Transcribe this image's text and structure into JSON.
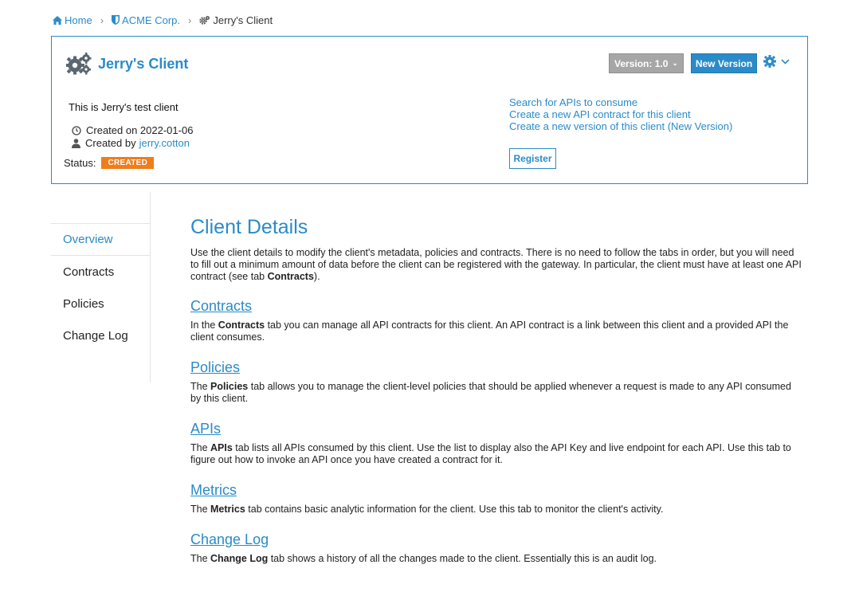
{
  "breadcrumb": {
    "home": "Home",
    "org": "ACME Corp.",
    "client": "Jerry's Client"
  },
  "header": {
    "title": "Jerry's Client",
    "version_label": "Version: 1.0",
    "new_version_label": "New Version",
    "description": "This is Jerry's test client",
    "created_on": "Created on 2022-01-06",
    "created_by_prefix": "Created by",
    "created_by_user": "jerry.cotton",
    "status_label": "Status:",
    "status_value": "CREATED",
    "links": {
      "search_apis": "Search for APIs to consume",
      "create_contract": "Create a new API contract for this client",
      "create_version": "Create a new version of this client (New Version)"
    },
    "register_label": "Register"
  },
  "nav": {
    "overview": "Overview",
    "contracts": "Contracts",
    "policies": "Policies",
    "changelog": "Change Log"
  },
  "content": {
    "heading": "Client Details",
    "intro": "Use the client details to modify the client's metadata, policies and contracts. There is no need to follow the tabs in order, but you will need to fill out a minimum amount of data before the client can be registered with the gateway. In particular, the client must have at least one API contract (see tab ",
    "intro_bold": "Contracts",
    "intro_end": ").",
    "sections": [
      {
        "title": "Contracts",
        "pre": "In the ",
        "bold": "Contracts",
        "post": " tab you can manage all API contracts for this client. An API contract is a link between this client and a provided API the client consumes."
      },
      {
        "title": "Policies",
        "pre": "The ",
        "bold": "Policies",
        "post": " tab allows you to manage the client-level policies that should be applied whenever a request is made to any API consumed by this client."
      },
      {
        "title": "APIs",
        "pre": "The ",
        "bold": "APIs",
        "post": " tab lists all APIs consumed by this client. Use the list to display also the API Key and live endpoint for each API. Use this tab to figure out how to invoke an API once you have created a contract for it."
      },
      {
        "title": "Metrics",
        "pre": "The ",
        "bold": "Metrics",
        "post": " tab contains basic analytic information for the client. Use this tab to monitor the client's activity."
      },
      {
        "title": "Change Log",
        "pre": "The ",
        "bold": "Change Log",
        "post": " tab shows a history of all the changes made to the client. Essentially this is an audit log."
      }
    ]
  },
  "colors": {
    "accent": "#2a8bc9",
    "status_created": "#f07c1a",
    "version_button": "#a6a6a6"
  }
}
